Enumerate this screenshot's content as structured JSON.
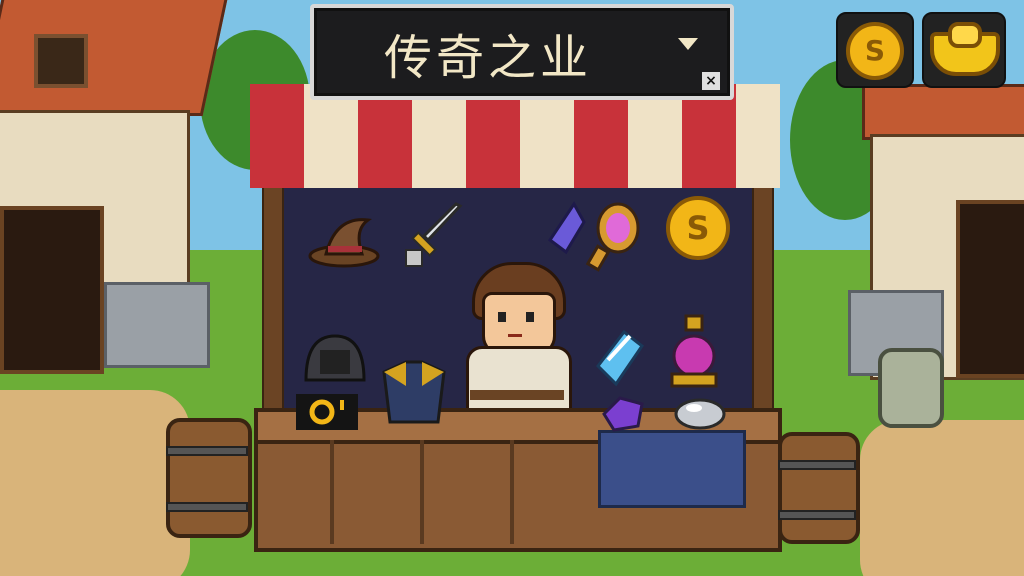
{
  "game": {
    "title": "传奇之业",
    "close_glyph": "×",
    "currency": {
      "coin_symbol": "S",
      "coin_icon": "gold-coin-icon",
      "ingot_icon": "gold-ingot-icon"
    },
    "shop_items": [
      {
        "name": "wizard-hat-icon"
      },
      {
        "name": "sword-icon"
      },
      {
        "name": "purple-crystal-icon"
      },
      {
        "name": "magic-mirror-icon"
      },
      {
        "name": "gold-coin-icon",
        "symbol": "S"
      },
      {
        "name": "iron-helmet-icon"
      },
      {
        "name": "gold-ring-icon"
      },
      {
        "name": "armor-chestplate-icon"
      },
      {
        "name": "blue-crystal-icon"
      },
      {
        "name": "pink-potion-icon"
      },
      {
        "name": "purple-gem-icon"
      },
      {
        "name": "silver-stone-icon"
      }
    ],
    "colors": {
      "awning_red": "#c8323a",
      "awning_cream": "#efe2c6",
      "gold": "#f2b617",
      "stall_backdrop": "#262646"
    }
  }
}
